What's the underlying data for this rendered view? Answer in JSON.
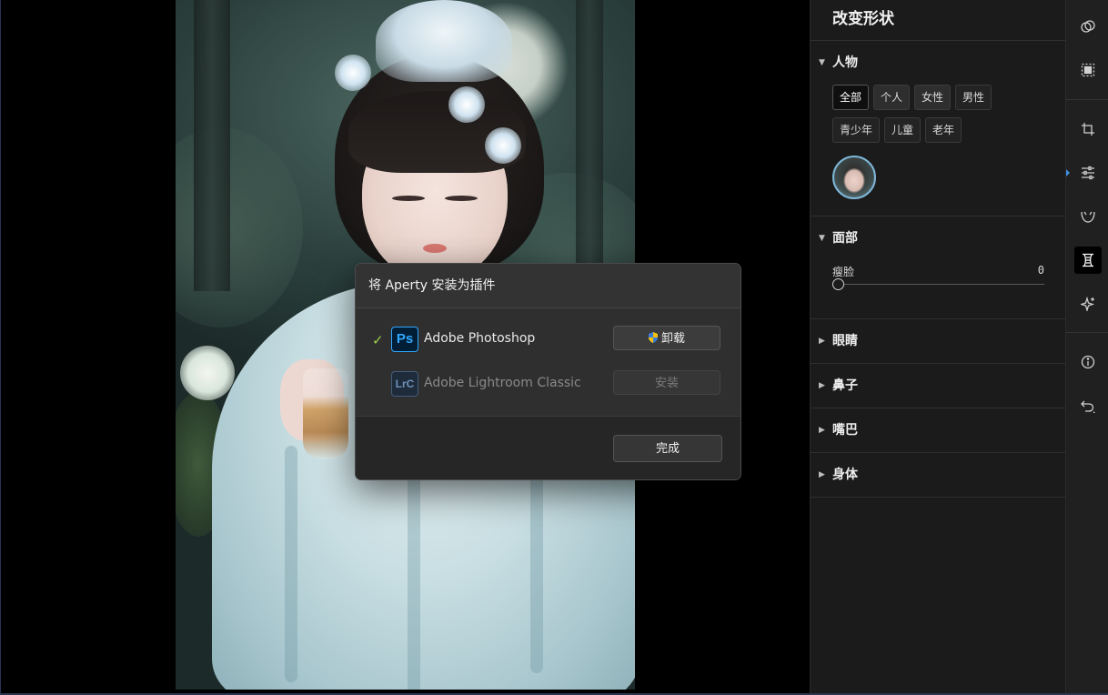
{
  "dialog": {
    "title": "将 Aperty 安装为插件",
    "apps": [
      {
        "icon": "Ps",
        "name": "Adobe Photoshop",
        "installed": true,
        "button": "卸载"
      },
      {
        "icon": "LrC",
        "name": "Adobe Lightroom Classic",
        "installed": false,
        "button": "安装"
      }
    ],
    "done_label": "完成",
    "check_glyph": "✓"
  },
  "panel": {
    "title": "改变形状",
    "people": {
      "label": "人物",
      "filters_row1": [
        "全部",
        "个人",
        "女性",
        "男性"
      ],
      "filters_row2": [
        "青少年",
        "儿童",
        "老年"
      ],
      "active_filter": "全部"
    },
    "face": {
      "label": "面部",
      "slider_label": "瘦脸",
      "slider_value": "0"
    },
    "collapsed_sections": [
      "眼睛",
      "鼻子",
      "嘴巴",
      "身体"
    ]
  },
  "toolbar": {
    "icons": [
      "overlap-circles-icon",
      "select-subject-icon",
      "crop-icon",
      "adjust-sliders-icon",
      "face-shape-icon",
      "body-shape-icon",
      "sparkle-icon",
      "info-icon",
      "undo-icon"
    ],
    "active": "body-shape-icon"
  },
  "colors": {
    "accent_check": "#9fd14a",
    "photoshop_blue": "#31a8ff",
    "avatar_ring": "#7fb7d9"
  }
}
